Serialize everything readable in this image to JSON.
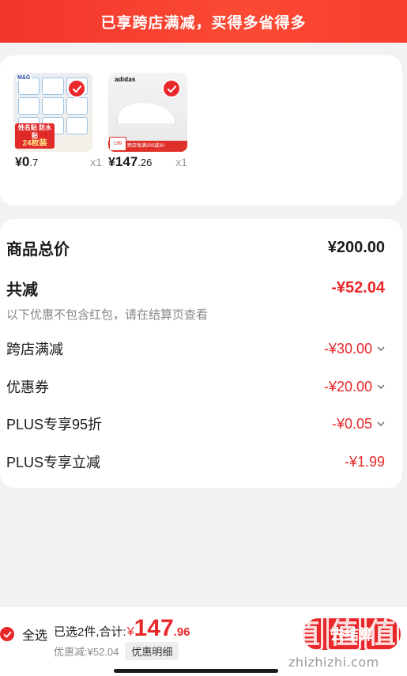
{
  "banner": {
    "text": "已享跨店满减，买得多省得多"
  },
  "products": [
    {
      "name": "sticker-labels",
      "brand": "M&G",
      "promo_small": "姓名贴 防水贴",
      "promo_big": "24枚装",
      "price_int": "0",
      "price_dec": ".7",
      "qty": "x1",
      "selected": true
    },
    {
      "name": "adidas-shoe",
      "brand": "adidas",
      "promo_tag": "199",
      "promo_strip": "跨店每满200减30",
      "price_int": "147",
      "price_dec": ".26",
      "qty": "x1",
      "selected": true
    }
  ],
  "summary": {
    "total_label": "商品总价",
    "total_value": "¥200.00",
    "reduce_label": "共减",
    "reduce_value": "-¥52.04",
    "note": "以下优惠不包含红包，请在结算页查看",
    "items": [
      {
        "label": "跨店满减",
        "value": "-¥30.00",
        "expandable": true
      },
      {
        "label": "优惠券",
        "value": "-¥20.00",
        "expandable": true
      },
      {
        "label": "PLUS专享95折",
        "value": "-¥0.05",
        "expandable": true
      },
      {
        "label": "PLUS专享立减",
        "value": "-¥1.99",
        "expandable": false
      }
    ]
  },
  "bottom": {
    "select_all": "全选",
    "selected_prefix": "已选2件,合计:",
    "total_yen": "¥",
    "total_int": "147",
    "total_dec": ".96",
    "saved": "优惠减:¥52.04",
    "detail_button": "优惠明细",
    "checkout_button": "去结算"
  },
  "watermark": {
    "chars": [
      "值",
      "值",
      "值"
    ],
    "url": "zhizhizhi.com"
  },
  "colors": {
    "accent": "#e8282a",
    "banner": "#f63d2e",
    "muted": "#888888"
  }
}
